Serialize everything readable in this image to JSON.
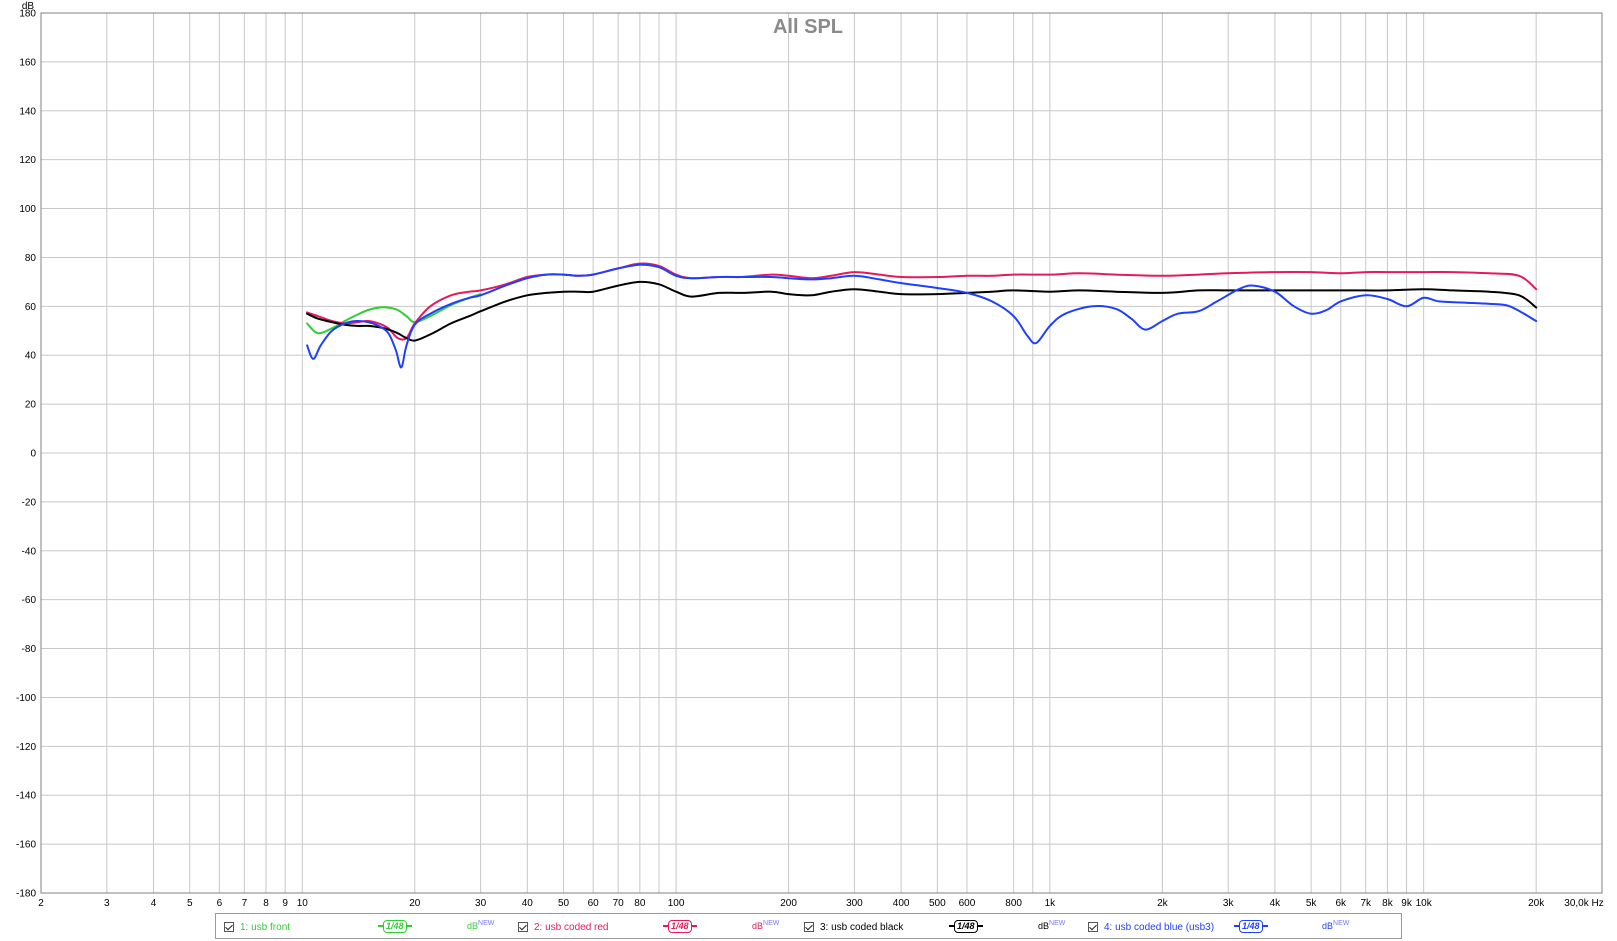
{
  "title": "All SPL",
  "chart_data": {
    "type": "line",
    "title": "All SPL",
    "xlabel": "Hz",
    "ylabel": "dB",
    "x_scale": "log",
    "xlim": [
      2,
      30000
    ],
    "ylim": [
      -180,
      180
    ],
    "grid": true,
    "legend_placement": "bottom",
    "y_ticks": [
      180,
      160,
      140,
      120,
      100,
      80,
      60,
      40,
      20,
      0,
      -20,
      -40,
      -60,
      -80,
      -100,
      -120,
      -140,
      -160,
      -180
    ],
    "x_ticks": [
      {
        "v": 2,
        "label": "2"
      },
      {
        "v": 3,
        "label": "3"
      },
      {
        "v": 4,
        "label": "4"
      },
      {
        "v": 5,
        "label": "5"
      },
      {
        "v": 6,
        "label": "6"
      },
      {
        "v": 7,
        "label": "7"
      },
      {
        "v": 8,
        "label": "8"
      },
      {
        "v": 9,
        "label": "9"
      },
      {
        "v": 10,
        "label": "10"
      },
      {
        "v": 20,
        "label": "20"
      },
      {
        "v": 30,
        "label": "30"
      },
      {
        "v": 40,
        "label": "40"
      },
      {
        "v": 50,
        "label": "50"
      },
      {
        "v": 60,
        "label": "60"
      },
      {
        "v": 70,
        "label": "70"
      },
      {
        "v": 80,
        "label": "80"
      },
      {
        "v": 100,
        "label": "100"
      },
      {
        "v": 200,
        "label": "200"
      },
      {
        "v": 300,
        "label": "300"
      },
      {
        "v": 400,
        "label": "400"
      },
      {
        "v": 500,
        "label": "500"
      },
      {
        "v": 600,
        "label": "600"
      },
      {
        "v": 800,
        "label": "800"
      },
      {
        "v": 1000,
        "label": "1k"
      },
      {
        "v": 2000,
        "label": "2k"
      },
      {
        "v": 3000,
        "label": "3k"
      },
      {
        "v": 4000,
        "label": "4k"
      },
      {
        "v": 5000,
        "label": "5k"
      },
      {
        "v": 6000,
        "label": "6k"
      },
      {
        "v": 7000,
        "label": "7k"
      },
      {
        "v": 8000,
        "label": "8k"
      },
      {
        "v": 9000,
        "label": "9k"
      },
      {
        "v": 10000,
        "label": "10k"
      },
      {
        "v": 20000,
        "label": "20k"
      },
      {
        "v": 30000,
        "label": "30,0k Hz"
      }
    ],
    "minor_x_gridlines": [
      90,
      900,
      90000
    ],
    "series": [
      {
        "name": "1: usb front",
        "color": "#33cc33",
        "x": [
          10.3,
          11,
          12,
          13,
          14,
          15,
          16,
          17,
          18,
          19,
          20,
          22,
          25,
          28,
          30
        ],
        "y": [
          53,
          49,
          51,
          54,
          56.5,
          58.5,
          59.5,
          59.5,
          58.5,
          56,
          53.5,
          56,
          60.5,
          63.5,
          65
        ]
      },
      {
        "name": "2: usb coded red",
        "color": "#e6195a",
        "x": [
          10.3,
          11,
          12,
          13,
          14,
          15,
          16,
          17,
          18,
          19,
          20,
          22,
          25,
          28,
          30,
          35,
          40,
          45,
          50,
          55,
          60,
          70,
          80,
          90,
          100,
          110,
          130,
          150,
          180,
          200,
          230,
          260,
          300,
          350,
          400,
          500,
          600,
          700,
          800,
          1000,
          1200,
          1500,
          2000,
          2500,
          3000,
          4000,
          5000,
          6000,
          7000,
          8000,
          10000,
          12000,
          15000,
          18000,
          20000
        ],
        "y": [
          57.5,
          56,
          54,
          53,
          53.5,
          54,
          53,
          51,
          47,
          47,
          53,
          60,
          64.5,
          66,
          66.5,
          69,
          72,
          73,
          73,
          72.5,
          73,
          75.5,
          77.5,
          76.5,
          73,
          71.5,
          72,
          72,
          73,
          72.5,
          71.5,
          72.5,
          74,
          73,
          72,
          72,
          72.5,
          72.5,
          73,
          73,
          73.5,
          73,
          72.5,
          73,
          73.5,
          74,
          74,
          73.5,
          74,
          74,
          74,
          74,
          73.5,
          72.5,
          67
        ]
      },
      {
        "name": "3: usb coded black",
        "color": "#000000",
        "x": [
          10.3,
          11,
          12,
          13,
          14,
          15,
          16,
          17,
          18,
          19,
          20,
          22,
          25,
          28,
          30,
          35,
          40,
          45,
          50,
          55,
          60,
          70,
          80,
          90,
          100,
          110,
          130,
          150,
          180,
          200,
          230,
          260,
          300,
          350,
          400,
          500,
          600,
          700,
          800,
          1000,
          1200,
          1500,
          2000,
          2500,
          3000,
          4000,
          5000,
          6000,
          7000,
          8000,
          10000,
          12000,
          15000,
          18000,
          20000
        ],
        "y": [
          57,
          55,
          53.5,
          52.5,
          52,
          52,
          51.5,
          50.5,
          49,
          47,
          46,
          48.5,
          53,
          56,
          58,
          62,
          64.5,
          65.5,
          66,
          66,
          66,
          68.5,
          70,
          69,
          66,
          64,
          65.5,
          65.5,
          66,
          65,
          64.5,
          66,
          67,
          66,
          65,
          65,
          65.5,
          66,
          66.5,
          66,
          66.5,
          66,
          65.5,
          66.5,
          66.5,
          66.5,
          66.5,
          66.5,
          66.5,
          66.5,
          67,
          66.5,
          66,
          64.5,
          59.5
        ]
      },
      {
        "name": "4: usb coded blue (usb3)",
        "color": "#1f3fff",
        "x": [
          10.3,
          10.7,
          11.2,
          12,
          13,
          14,
          15,
          16,
          17,
          17.8,
          18.4,
          19,
          20,
          22,
          25,
          28,
          30,
          35,
          40,
          45,
          50,
          55,
          60,
          70,
          80,
          90,
          100,
          110,
          130,
          150,
          180,
          200,
          230,
          260,
          300,
          350,
          400,
          500,
          600,
          700,
          800,
          870,
          920,
          1000,
          1100,
          1300,
          1500,
          1650,
          1800,
          2000,
          2200,
          2500,
          2800,
          3200,
          3500,
          4000,
          4500,
          5000,
          5500,
          6000,
          7000,
          8000,
          9000,
          10000,
          11000,
          13000,
          15000,
          17000,
          20000
        ],
        "y": [
          44,
          38.5,
          44,
          50,
          53,
          54,
          53.5,
          52,
          49,
          42,
          35,
          44,
          52.5,
          57,
          61,
          63.5,
          64.5,
          68.5,
          71.5,
          73,
          73,
          72.5,
          73,
          75.5,
          77,
          76,
          72.5,
          71.5,
          72,
          72,
          72,
          71.5,
          71,
          71.5,
          72.5,
          71,
          69.5,
          67.5,
          65.5,
          62,
          56,
          48,
          45,
          52,
          57,
          60,
          59,
          55,
          50.5,
          54,
          57,
          58,
          62,
          67,
          68.5,
          66,
          60,
          57,
          58.5,
          62,
          64.5,
          63,
          60,
          63.5,
          62,
          61.5,
          61,
          60,
          54
        ]
      }
    ]
  },
  "legend": [
    {
      "label": "1: usb front",
      "color": "#33cc33",
      "smoothing": "1/48",
      "unit": "dB",
      "unit_badge": "NEW"
    },
    {
      "label": "2: usb coded red",
      "color": "#e6195a",
      "smoothing": "1/48",
      "unit": "dB",
      "unit_badge": "NEW"
    },
    {
      "label": "3: usb coded black",
      "color": "#000000",
      "smoothing": "1/48",
      "unit": "dB",
      "unit_badge": "NEW"
    },
    {
      "label": "4: usb coded blue (usb3)",
      "color": "#1f3fff",
      "smoothing": "1/48",
      "unit": "dB",
      "unit_badge": "NEW"
    }
  ],
  "colors": {
    "grid": "#c8c8c8",
    "axis": "#808080",
    "title": "#8a8a8a"
  }
}
